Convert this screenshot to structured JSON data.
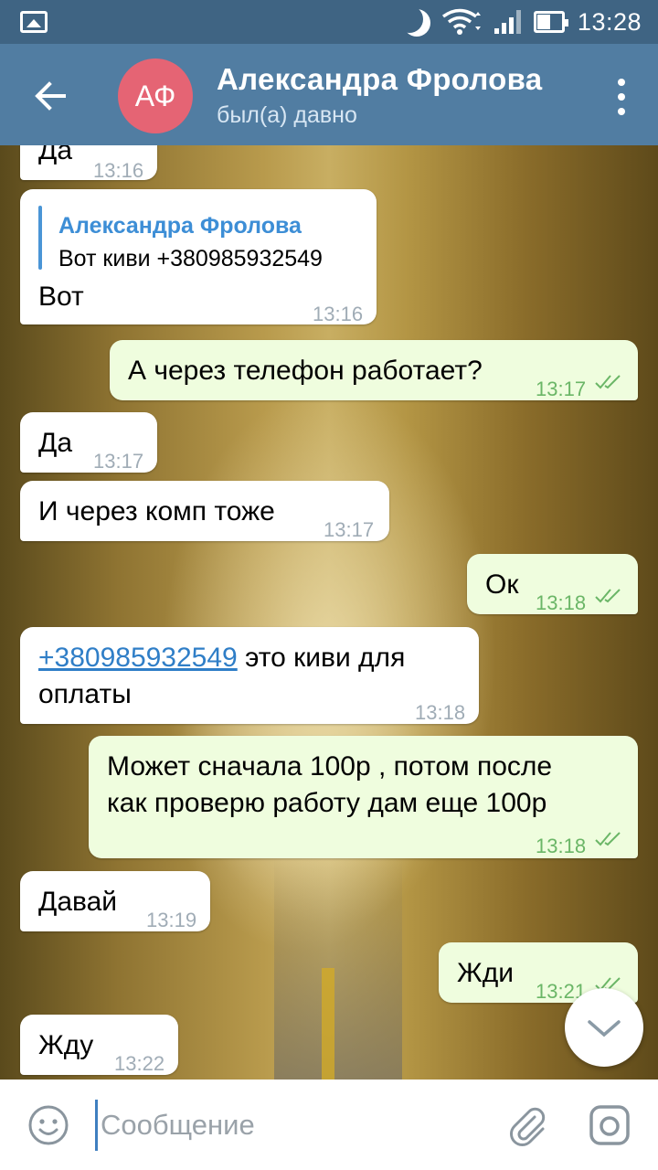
{
  "status_bar": {
    "time": "13:28"
  },
  "header": {
    "avatar_initials": "АФ",
    "name": "Александра Фролова",
    "status": "был(а) давно"
  },
  "messages": [
    {
      "direction": "in",
      "text": "Да",
      "time": "13:16"
    },
    {
      "direction": "in",
      "reply_to_name": "Александра Фролова",
      "reply_to_text": "Вот киви +380985932549",
      "text": "Вот",
      "time": "13:16"
    },
    {
      "direction": "out",
      "text": "А через телефон работает?",
      "time": "13:17",
      "read": true
    },
    {
      "direction": "in",
      "text": "Да",
      "time": "13:17"
    },
    {
      "direction": "in",
      "text": "И через комп тоже",
      "time": "13:17"
    },
    {
      "direction": "out",
      "text": "Ок",
      "time": "13:18",
      "read": true
    },
    {
      "direction": "in",
      "link": "+380985932549",
      "text_after_link": " это киви для",
      "text_line2": "оплаты",
      "time": "13:18"
    },
    {
      "direction": "out",
      "text_line1": "Может сначала 100р , потом после",
      "text_line2": "как проверю работу дам еще 100р",
      "time": "13:18",
      "read": true
    },
    {
      "direction": "in",
      "text": "Давай",
      "time": "13:19"
    },
    {
      "direction": "out",
      "text": "Жди",
      "time": "13:21",
      "read": true
    },
    {
      "direction": "in",
      "text": "Жду",
      "time": "13:22"
    }
  ],
  "input": {
    "placeholder": "Сообщение"
  },
  "colors": {
    "header": "#517da2",
    "status_bar": "#3f6483",
    "outgoing_bubble": "#effdde",
    "incoming_bubble": "#ffffff",
    "read_ticks": "#6bb667"
  },
  "icons": [
    "back-arrow-icon",
    "menu-dots-icon",
    "emoji-icon",
    "paperclip-icon",
    "camera-icon",
    "chevron-down-icon",
    "double-check-icon"
  ]
}
